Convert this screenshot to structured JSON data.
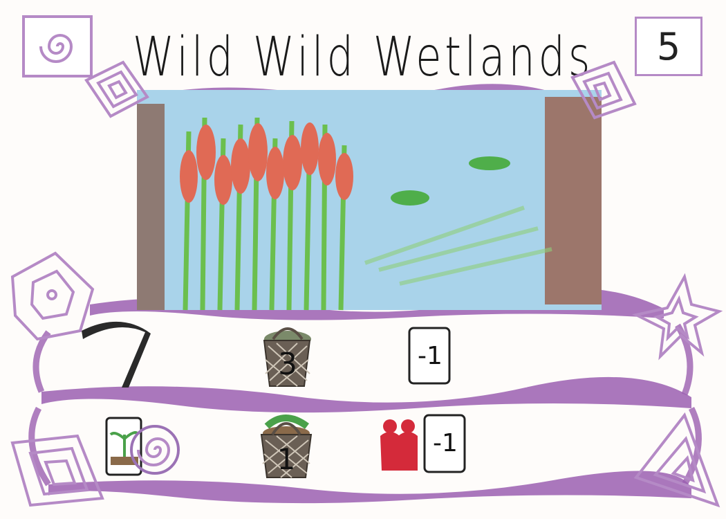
{
  "card": {
    "title": "Wild Wild Wetlands",
    "cost": "5",
    "illustration_icon": "wetland-scene-icon",
    "colors": {
      "border_purple": "#9b5fb0",
      "symbol_purple": "#b58ac6",
      "water_blue": "#a9d3ea",
      "cattail_red": "#e06a55",
      "reed_green": "#6bbf4e",
      "bank_brown": "#8a5a48"
    },
    "corner_symbols": {
      "top_left": "spiral-square-icon",
      "top_left_inner": "nested-diamond-icon",
      "top_right_inner": "nested-diamond-icon",
      "left_middle": "hexagon-icon",
      "right_middle": "star-icon",
      "bottom_left": "nested-diamond-icon",
      "bottom_right": "triangle-icon"
    },
    "row1": {
      "tool_icon": "scythe-icon",
      "basket_icon": "basket-icon",
      "basket_value": "3",
      "card_icon": "card-icon",
      "card_value": "-1"
    },
    "row2": {
      "seedling_icon": "seedling-card-icon",
      "spiral_icon": "spiral-icon",
      "basket_icon": "basket-icon",
      "basket_value": "1",
      "people_icon": "people-icon",
      "card_icon": "card-icon",
      "card_value": "-1"
    }
  }
}
